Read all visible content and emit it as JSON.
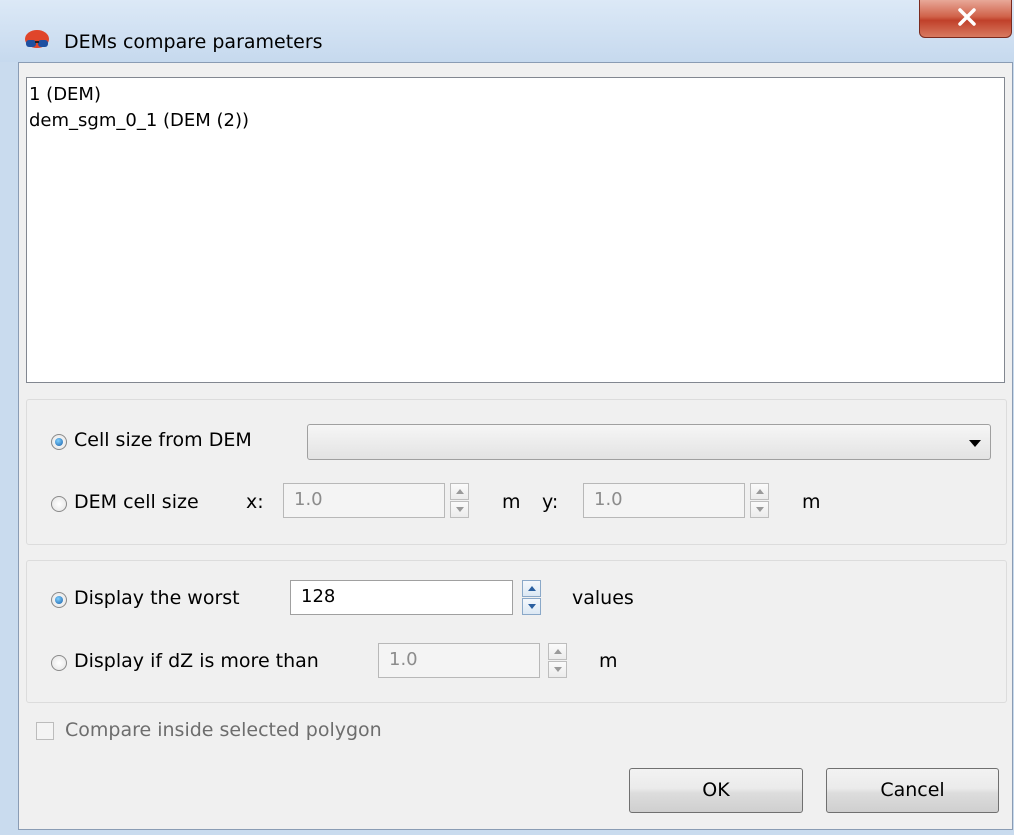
{
  "window": {
    "title": "DEMs compare parameters",
    "icon": "red-glasses-icon",
    "close_icon": "close-icon"
  },
  "dem_list": {
    "items": [
      "1 (DEM)",
      "dem_sgm_0_1 (DEM (2))"
    ]
  },
  "cell_size": {
    "from_dem_label": "Cell size from DEM",
    "from_dem_selected": true,
    "from_dem_value": "",
    "dem_cell_size_label": "DEM cell size",
    "x_label": "x:",
    "x_value": "1.0",
    "x_unit": "m",
    "y_label": "y:",
    "y_value": "1.0",
    "y_unit": "m"
  },
  "display": {
    "worst_label": "Display the worst",
    "worst_selected": true,
    "worst_value": "128",
    "worst_unit": "values",
    "dz_label": "Display if dZ is more than",
    "dz_value": "1.0",
    "dz_unit": "m"
  },
  "polygon_checkbox": {
    "label": "Compare inside selected polygon",
    "checked": false
  },
  "buttons": {
    "ok": "OK",
    "cancel": "Cancel"
  }
}
